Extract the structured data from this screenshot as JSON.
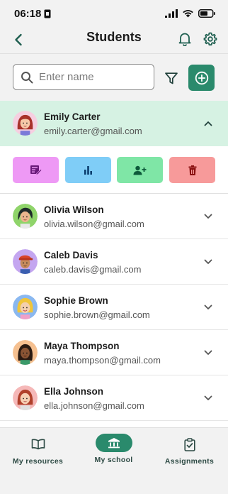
{
  "status_bar": {
    "time": "06:18"
  },
  "header": {
    "title": "Students"
  },
  "search": {
    "placeholder": "Enter name",
    "value": ""
  },
  "colors": {
    "accent": "#2a8a6c",
    "expanded_bg": "#d6f2e3",
    "action_purple": "#ee99f5",
    "action_blue": "#7fcdf7",
    "action_green": "#7fe6a6",
    "action_red": "#f79a9a"
  },
  "students": [
    {
      "name": "Emily Carter",
      "email": "emily.carter@gmail.com",
      "expanded": true,
      "avatar": "avatar-red-hair"
    },
    {
      "name": "Olivia Wilson",
      "email": "olivia.wilson@gmail.com",
      "expanded": false,
      "avatar": "avatar-dark-hair"
    },
    {
      "name": "Caleb Davis",
      "email": "caleb.davis@gmail.com",
      "expanded": false,
      "avatar": "avatar-cap"
    },
    {
      "name": "Sophie Brown",
      "email": "sophie.brown@gmail.com",
      "expanded": false,
      "avatar": "avatar-blonde"
    },
    {
      "name": "Maya Thompson",
      "email": "maya.thompson@gmail.com",
      "expanded": false,
      "avatar": "avatar-braids"
    },
    {
      "name": "Ella Johnson",
      "email": "ella.johnson@gmail.com",
      "expanded": false,
      "avatar": "avatar-red-hair-2"
    }
  ],
  "actions": [
    {
      "icon": "assignment-icon",
      "color": "#ee99f5"
    },
    {
      "icon": "bar-chart-icon",
      "color": "#7fcdf7"
    },
    {
      "icon": "add-person-icon",
      "color": "#7fe6a6"
    },
    {
      "icon": "trash-icon",
      "color": "#f79a9a"
    }
  ],
  "bottom_nav": [
    {
      "label": "My resources",
      "icon": "book-icon",
      "active": false
    },
    {
      "label": "My school",
      "icon": "school-icon",
      "active": true
    },
    {
      "label": "Assignments",
      "icon": "clipboard-check-icon",
      "active": false
    }
  ]
}
